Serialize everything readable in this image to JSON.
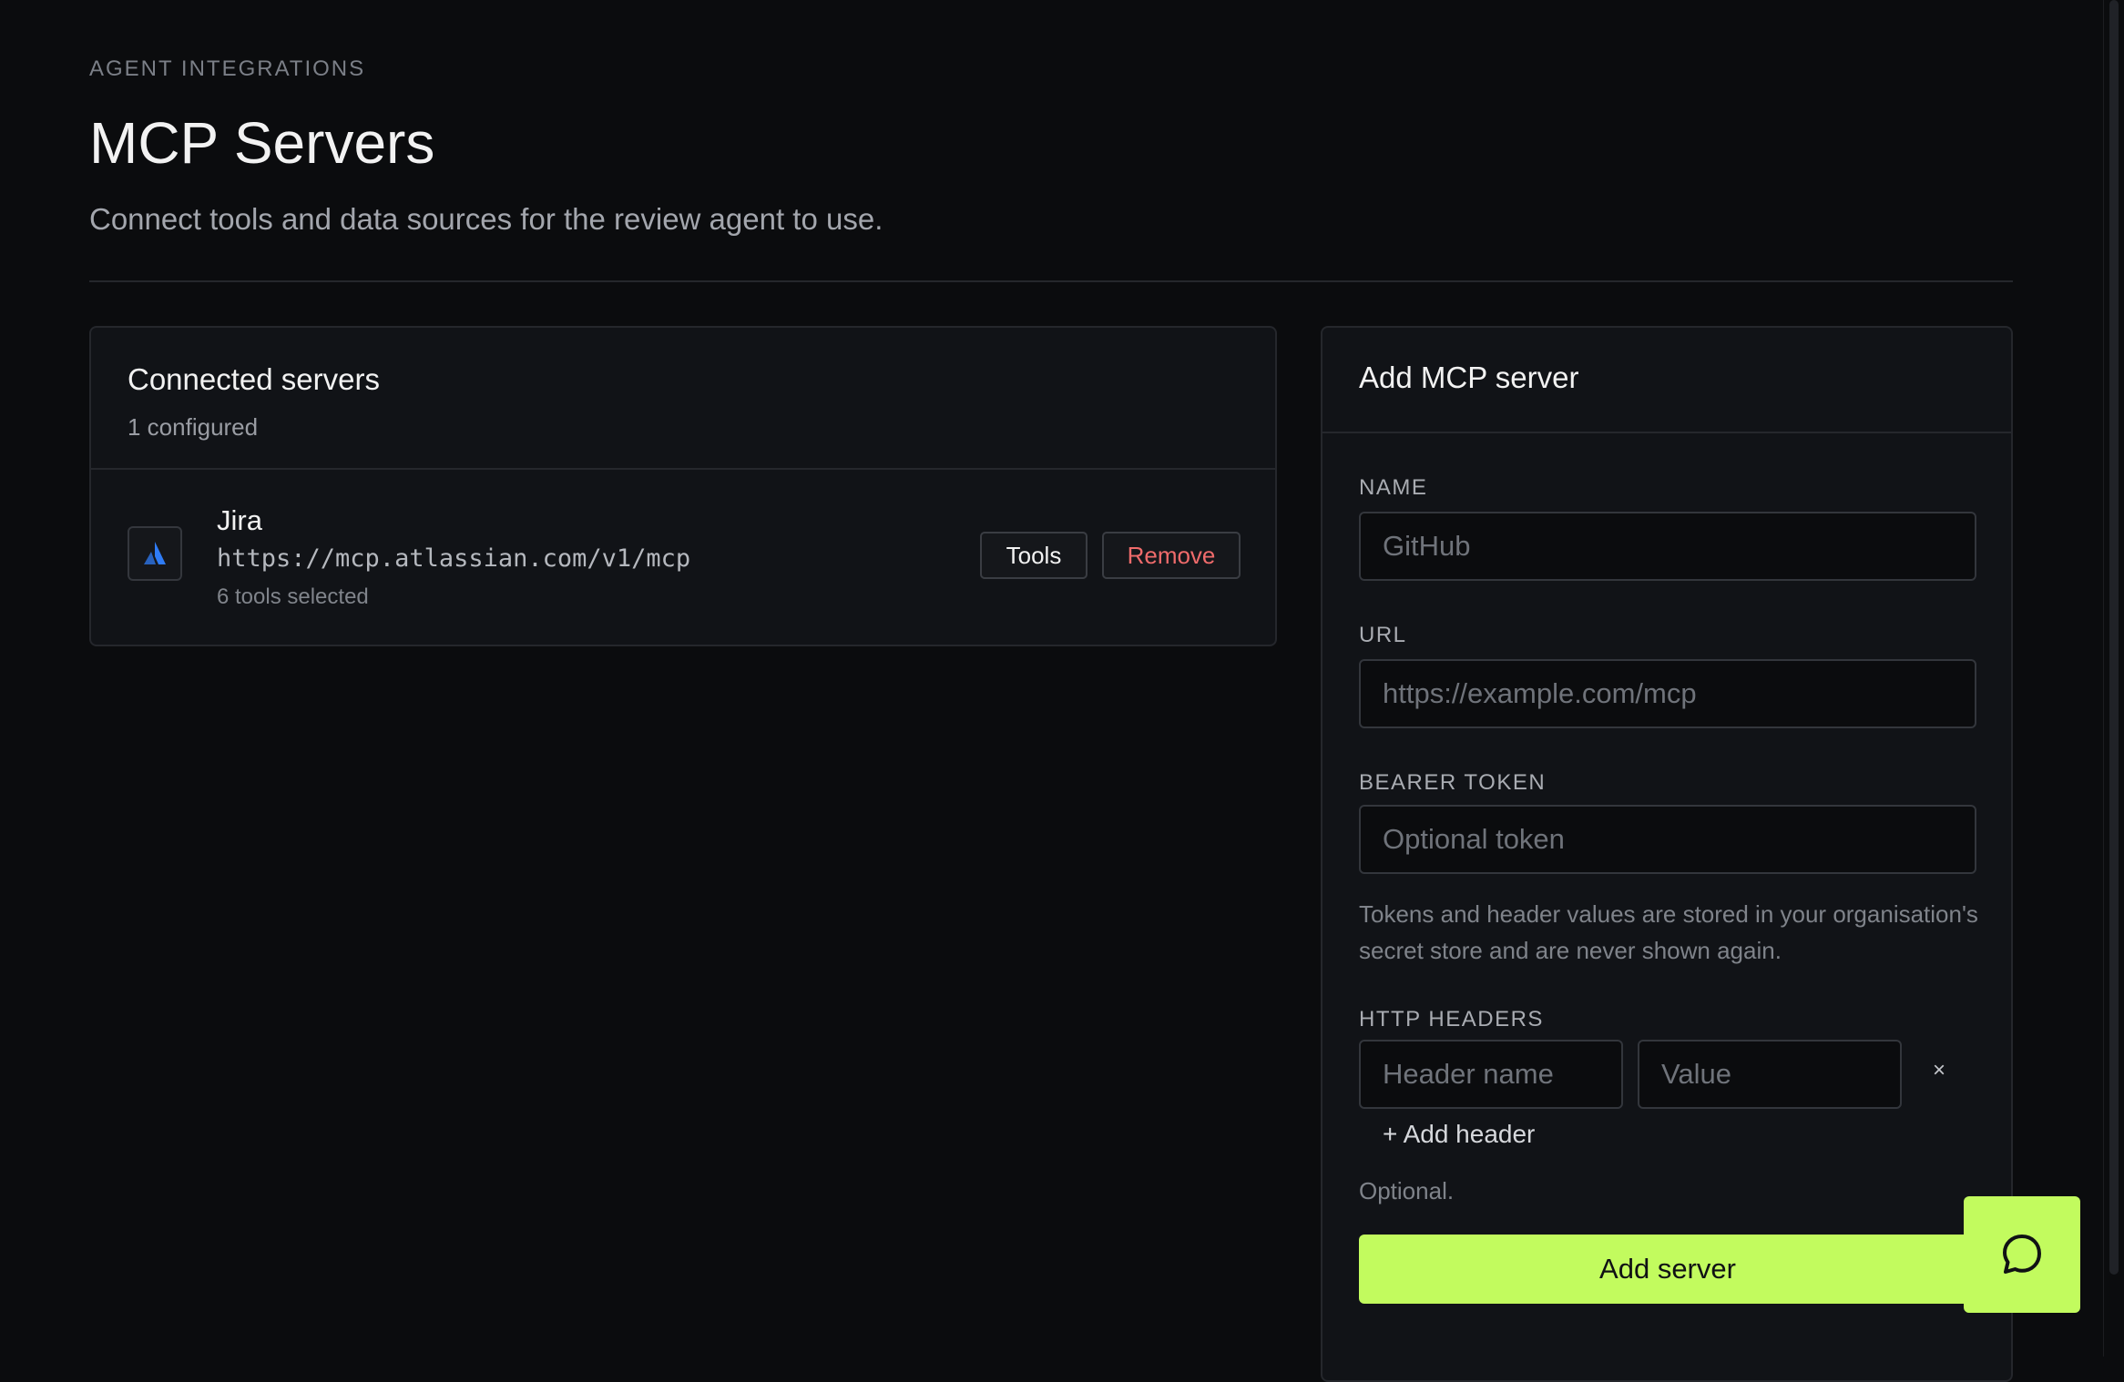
{
  "header": {
    "eyebrow": "AGENT INTEGRATIONS",
    "title": "MCP Servers",
    "subtitle": "Connect tools and data sources for the review agent to use."
  },
  "connected": {
    "title": "Connected servers",
    "count_text": "1 configured",
    "servers": [
      {
        "name": "Jira",
        "url": "https://mcp.atlassian.com/v1/mcp",
        "tools_text": "6 tools selected",
        "icon": "atlassian-logo-icon",
        "tools_label": "Tools",
        "remove_label": "Remove"
      }
    ]
  },
  "add_server": {
    "title": "Add MCP server",
    "name_label": "NAME",
    "name_placeholder": "GitHub",
    "url_label": "URL",
    "url_placeholder": "https://example.com/mcp",
    "token_label": "BEARER TOKEN",
    "token_placeholder": "Optional token",
    "token_hint": "Tokens and header values are stored in your organisation's secret store and are never shown again.",
    "headers_label": "HTTP HEADERS",
    "header_name_placeholder": "Header name",
    "header_value_placeholder": "Value",
    "remove_header_label": "×",
    "add_header_label": "+ Add header",
    "headers_hint": "Optional.",
    "submit_label": "Add server"
  },
  "chat": {
    "icon": "chat-bubble-icon"
  },
  "colors": {
    "background": "#0b0c0e",
    "accent": "#c2fb5e",
    "danger": "#ef6b6b",
    "atlassian_blue": "#2f7cf6"
  }
}
